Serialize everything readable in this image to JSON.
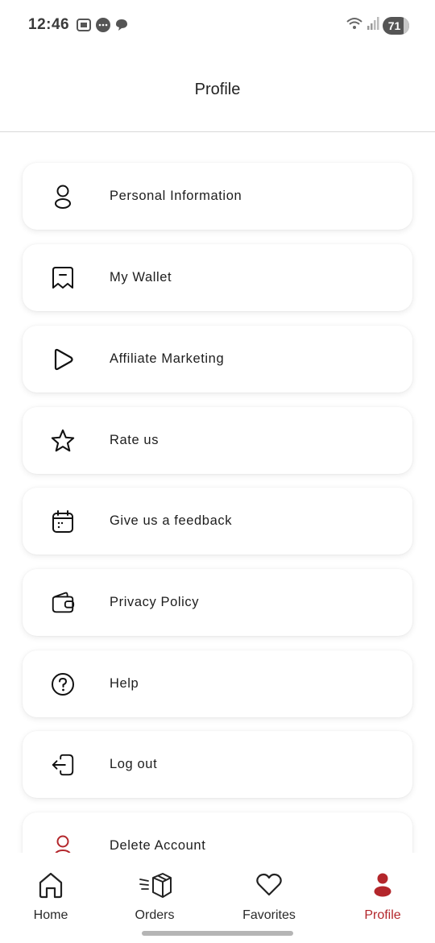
{
  "status_bar": {
    "time": "12:46",
    "battery": "71",
    "left_icons": [
      "screenshot-icon",
      "chat-bubble-icon",
      "message-icon"
    ],
    "right_icons": [
      "wifi-icon",
      "signal-icon"
    ]
  },
  "header": {
    "title": "Profile"
  },
  "menu": {
    "items": [
      {
        "label": "Personal Information",
        "icon": "user-icon"
      },
      {
        "label": "My Wallet",
        "icon": "wallet-icon"
      },
      {
        "label": "Affiliate Marketing",
        "icon": "play-icon"
      },
      {
        "label": "Rate us",
        "icon": "star-icon"
      },
      {
        "label": "Give us a feedback",
        "icon": "calendar-icon"
      },
      {
        "label": "Privacy Policy",
        "icon": "purse-icon"
      },
      {
        "label": "Help",
        "icon": "question-icon"
      },
      {
        "label": "Log out",
        "icon": "logout-icon"
      },
      {
        "label": "Delete Account",
        "icon": "delete-user-icon"
      }
    ]
  },
  "bottom_nav": {
    "items": [
      {
        "label": "Home",
        "icon": "home-icon",
        "active": false
      },
      {
        "label": "Orders",
        "icon": "box-icon",
        "active": false
      },
      {
        "label": "Favorites",
        "icon": "heart-icon",
        "active": false
      },
      {
        "label": "Profile",
        "icon": "profile-icon",
        "active": true
      }
    ]
  },
  "colors": {
    "accent": "#b3262b",
    "text": "#1d1d1d",
    "divider": "#d9d9d9",
    "card_bg": "#ffffff"
  }
}
